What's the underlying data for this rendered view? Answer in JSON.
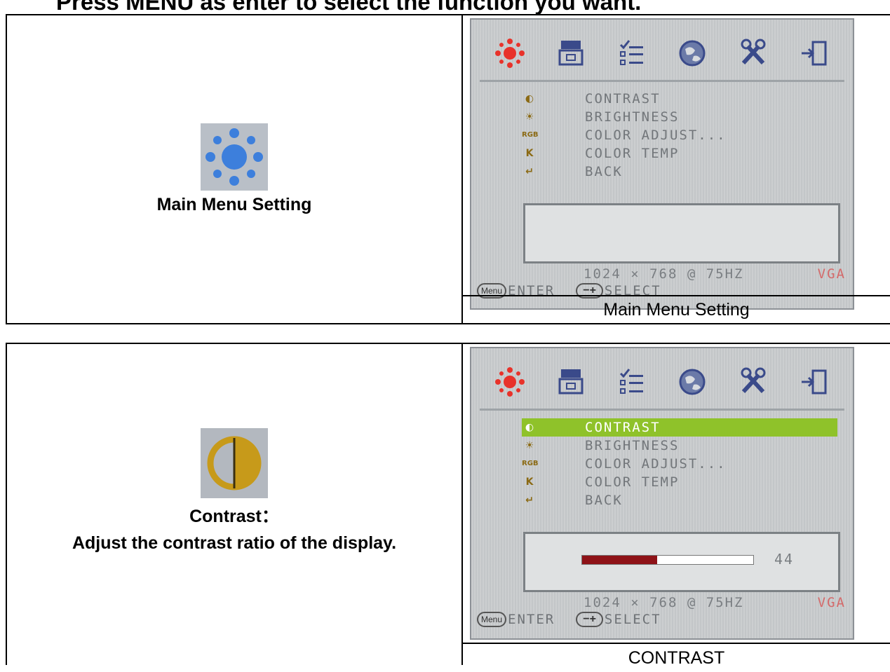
{
  "heading": "Press MENU as enter to select the function you want.",
  "osd": {
    "menu_items": [
      {
        "label": "CONTRAST",
        "icon": "contrast-icon"
      },
      {
        "label": "BRIGHTNESS",
        "icon": "brightness-icon"
      },
      {
        "label": "COLOR ADJUST...",
        "icon": "rgb-icon",
        "icon_text": "RGB"
      },
      {
        "label": "COLOR TEMP",
        "icon": "color-temp-icon",
        "icon_text": "K"
      },
      {
        "label": "BACK",
        "icon": "back-arrow-icon"
      }
    ],
    "resolution": "1024 × 768 @ 75HZ",
    "input": "VGA",
    "menu_key": "Menu",
    "enter_label": "ENTER",
    "plusminus_key": "−+",
    "select_label": "SELECT",
    "tabs": [
      "picture-sun-icon",
      "image-setting-icon",
      "osd-settings-list-icon",
      "language-globe-icon",
      "tools-icon",
      "exit-door-icon"
    ]
  },
  "sections": [
    {
      "left_title": "Main Menu Setting",
      "left_desc": "",
      "caption": "Main Menu Setting",
      "highlight_index": -1
    },
    {
      "left_title": "Contrast：",
      "left_desc": "Adjust the contrast ratio of the display.",
      "caption": "CONTRAST",
      "highlight_index": 0,
      "bar_value": "44",
      "bar_fraction": 0.44
    }
  ],
  "colors": {
    "active_tab": "#e8322a",
    "highlight": "#8fc22a",
    "bar_fill": "#8e1217",
    "vga_text": "#d46a6a"
  }
}
